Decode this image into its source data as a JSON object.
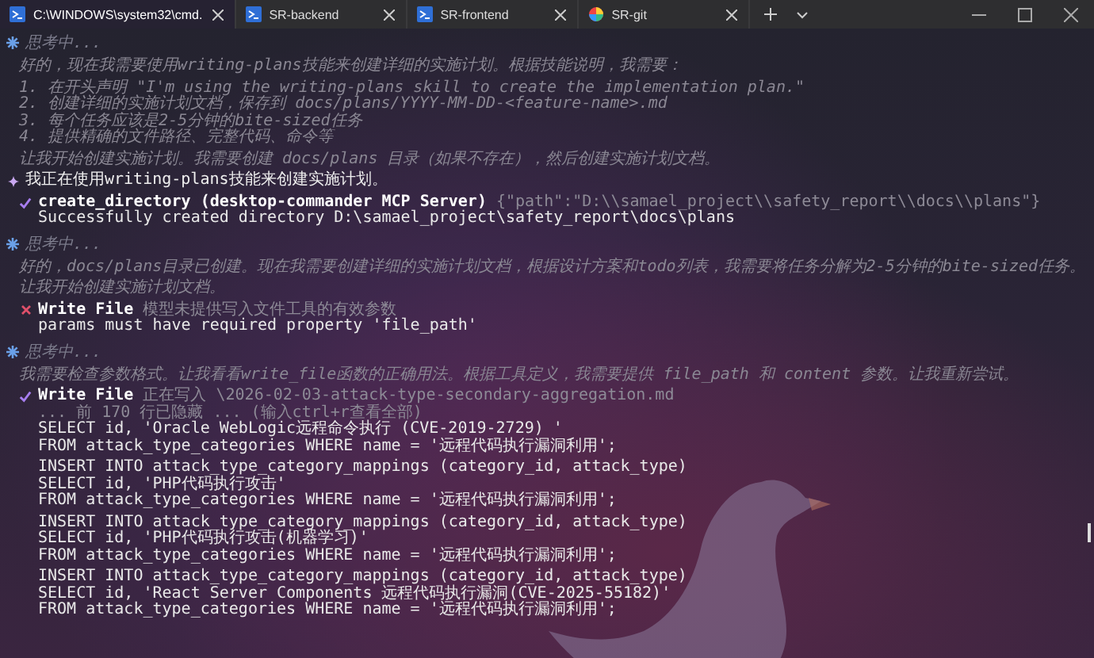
{
  "tabs": [
    {
      "label": "C:\\WINDOWS\\system32\\cmd.",
      "kind": "terminal",
      "selected": true
    },
    {
      "label": "SR-backend",
      "kind": "terminal",
      "selected": false
    },
    {
      "label": "SR-frontend",
      "kind": "terminal",
      "selected": false
    },
    {
      "label": "SR-git",
      "kind": "git",
      "selected": false
    }
  ],
  "transcript": [
    {
      "kind": "thinking",
      "label": "思考中..."
    },
    {
      "kind": "note",
      "paragraphs": [
        [
          "好的，现在我需要使用writing-plans技能来创建详细的实施计划。根据技能说明，我需要："
        ],
        [
          "1. 在开头声明 \"I'm using the writing-plans skill to create the implementation plan.\"",
          "2. 创建详细的实施计划文档，保存到 docs/plans/YYYY-MM-DD-<feature-name>.md",
          "3. 每个任务应该是2-5分钟的bite-sized任务",
          "4. 提供精确的文件路径、完整代码、命令等"
        ],
        [
          "让我开始创建实施计划。我需要创建 docs/plans 目录（如果不存在），然后创建实施计划文档。"
        ]
      ]
    },
    {
      "kind": "message",
      "text": "我正在使用writing-plans技能来创建实施计划。"
    },
    {
      "kind": "tool",
      "failed": false,
      "name": "create_directory (desktop-commander MCP Server)",
      "detail": "{\"path\":\"D:\\\\samael_project\\\\safety_report\\\\docs\\\\plans\"}",
      "output": [
        [
          "Successfully created directory D:\\samael_project\\safety_report\\docs\\plans"
        ]
      ]
    },
    {
      "kind": "thinking",
      "label": "思考中..."
    },
    {
      "kind": "note",
      "paragraphs": [
        [
          "好的，docs/plans目录已创建。现在我需要创建详细的实施计划文档，根据设计方案和todo列表，我需要将任务分解为2-5分钟的bite-sized任务。"
        ],
        [
          "让我开始创建实施计划文档。"
        ]
      ]
    },
    {
      "kind": "tool",
      "failed": true,
      "name": "Write File",
      "detail": "模型未提供写入文件工具的有效参数",
      "output": [
        [
          "params must have required property 'file_path'"
        ]
      ]
    },
    {
      "kind": "thinking",
      "label": "思考中..."
    },
    {
      "kind": "note",
      "paragraphs": [
        [
          "我需要检查参数格式。让我看看write_file函数的正确用法。根据工具定义，我需要提供 file_path 和 content 参数。让我重新尝试。"
        ]
      ]
    },
    {
      "kind": "tool",
      "failed": false,
      "name": "Write File",
      "detail": "正在写入 \\2026-02-03-attack-type-secondary-aggregation.md",
      "hidden": "... 前 170 行已隐藏 ... (输入ctrl+r查看全部)",
      "output": [
        [
          "SELECT id, 'Oracle WebLogic远程命令执行 (CVE-2019-2729) '",
          "FROM attack_type_categories WHERE name = '远程代码执行漏洞利用';"
        ],
        [
          "INSERT INTO attack_type_category_mappings (category_id, attack_type)",
          "SELECT id, 'PHP代码执行攻击'",
          "FROM attack_type_categories WHERE name = '远程代码执行漏洞利用';"
        ],
        [
          "INSERT INTO attack_type_category_mappings (category_id, attack_type)",
          "SELECT id, 'PHP代码执行攻击(机器学习)'",
          "FROM attack_type_categories WHERE name = '远程代码执行漏洞利用';"
        ],
        [
          "INSERT INTO attack_type_category_mappings (category_id, attack_type)",
          "SELECT id, 'React Server Components 远程代码执行漏洞(CVE-2025-55182)'",
          "FROM attack_type_categories WHERE name = '远程代码执行漏洞利用';"
        ]
      ]
    }
  ]
}
